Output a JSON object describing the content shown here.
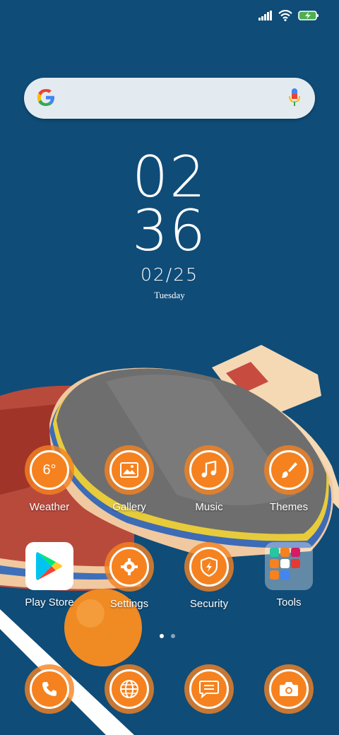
{
  "weather": {
    "temp": "6°"
  },
  "apps": [
    {
      "label": "Weather"
    },
    {
      "label": "Gallery"
    },
    {
      "label": "Music"
    },
    {
      "label": "Themes"
    },
    {
      "label": "Play Store"
    },
    {
      "label": "Settings"
    },
    {
      "label": "Security"
    },
    {
      "label": "Tools"
    }
  ],
  "clock": {
    "hour": "02",
    "minute": "36",
    "date": "02/25",
    "day": "Tuesday"
  },
  "pager": {
    "pages": 2,
    "current": 1
  },
  "colors": {
    "accent": "#f5821f",
    "background": "#0f4c78"
  },
  "dock": [
    "phone-icon",
    "browser-icon",
    "messages-icon",
    "camera-icon"
  ]
}
